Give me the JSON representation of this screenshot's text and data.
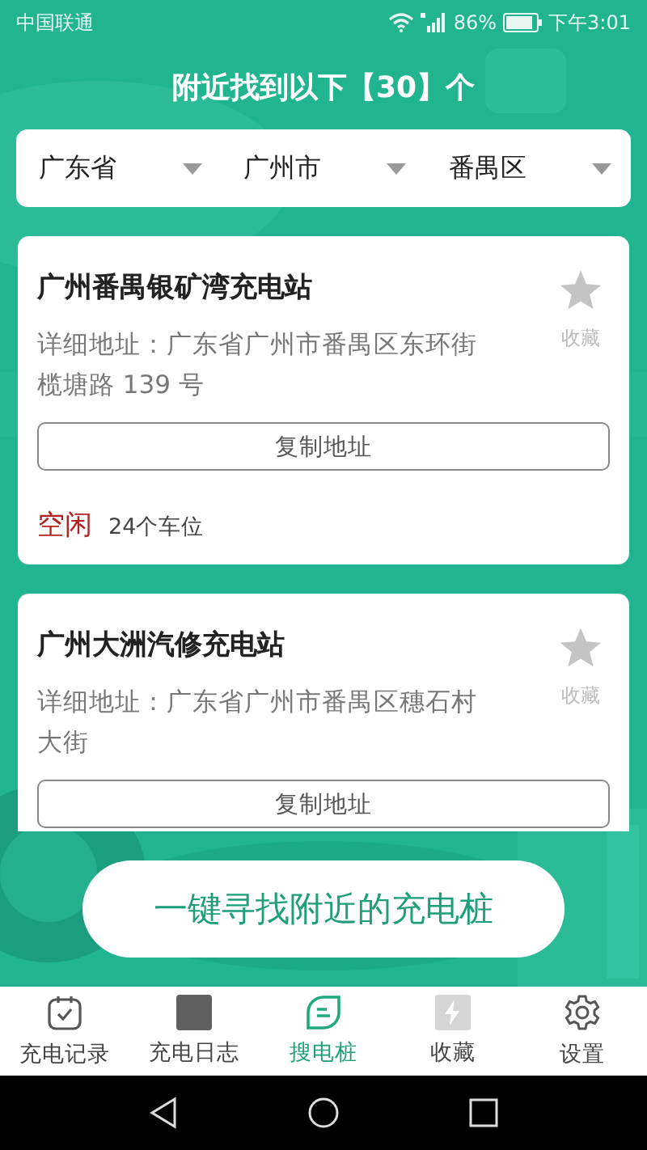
{
  "status_bar": {
    "carrier": "中国联通",
    "battery": "86%",
    "time": "下午3:01"
  },
  "header": {
    "title": "附近找到以下【30】个"
  },
  "filters": [
    {
      "label": "广东省"
    },
    {
      "label": "广州市"
    },
    {
      "label": "番禺区"
    }
  ],
  "stations": [
    {
      "name": "广州番禺银矿湾充电站",
      "address": "详细地址：广东省广州市番禺区东环街榄塘路 139 号",
      "favorite_label": "收藏",
      "favorited": false,
      "copy_button": "复制地址",
      "status": "空闲",
      "spots": "24个车位"
    },
    {
      "name": "广州大洲汽修充电站",
      "address": "详细地址：广东省广州市番禺区穗石村大街",
      "favorite_label": "收藏",
      "favorited": false,
      "copy_button": "复制地址"
    }
  ],
  "find_button": "一键寻找附近的充电桩",
  "nav": [
    {
      "label": "充电记录",
      "kind": "calendar",
      "selected": false
    },
    {
      "label": "充电日志",
      "kind": "log",
      "selected": false
    },
    {
      "label": "搜电桩",
      "kind": "search",
      "selected": true
    },
    {
      "label": "收藏",
      "kind": "favorite",
      "selected": false
    },
    {
      "label": "设置",
      "kind": "settings",
      "selected": false
    }
  ]
}
